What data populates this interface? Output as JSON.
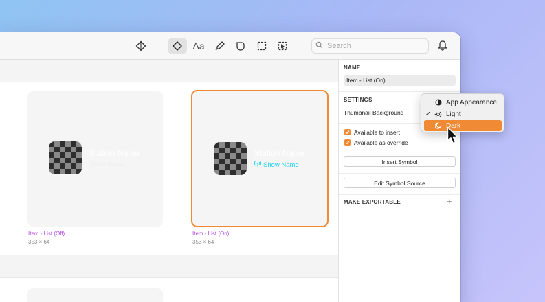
{
  "toolbar": {
    "icons": [
      "component-icon",
      "symbol-icon",
      "text-style-icon",
      "color-picker-icon",
      "layer-style-icon",
      "frame-icon",
      "cursor-select-icon"
    ],
    "search": {
      "placeholder": "Search"
    },
    "notifications_icon": "bell-icon"
  },
  "canvas": {
    "cards": [
      {
        "station": "Station Name",
        "show": "Show Name",
        "name": "Item - List (Off)",
        "size": "353 × 64",
        "state": "off"
      },
      {
        "station": "Station Name",
        "show": "Show Name",
        "name": "Item - List (On)",
        "size": "353 × 64",
        "state": "on",
        "selected": true
      }
    ]
  },
  "panel": {
    "name_label": "NAME",
    "name_value": "Item - List (On)",
    "settings_label": "SETTINGS",
    "thumbnail_background_label": "Thumbnail Background",
    "available_to_insert": {
      "label": "Available to insert",
      "checked": true
    },
    "available_as_override": {
      "label": "Available as override",
      "checked": true
    },
    "insert_symbol_button": "Insert Symbol",
    "edit_symbol_source_button": "Edit Symbol Source",
    "make_exportable_label": "MAKE EXPORTABLE",
    "add_export_icon": "plus-icon"
  },
  "dropdown": {
    "items": [
      {
        "label": "App Appearance",
        "icon": "half-circle-icon",
        "checked": false,
        "highlighted": false
      },
      {
        "label": "Light",
        "icon": "sun-icon",
        "checked": true,
        "highlighted": false
      },
      {
        "label": "Dark",
        "icon": "moon-icon",
        "checked": false,
        "highlighted": true
      }
    ],
    "check_glyph": "✓"
  },
  "colors": {
    "accent": "#f08a34",
    "symbol_name": "#b049e0",
    "show_name_on": "#22d3ee",
    "background_gradient_start": "#8fc4f3",
    "background_gradient_end": "#c7c4fb"
  }
}
